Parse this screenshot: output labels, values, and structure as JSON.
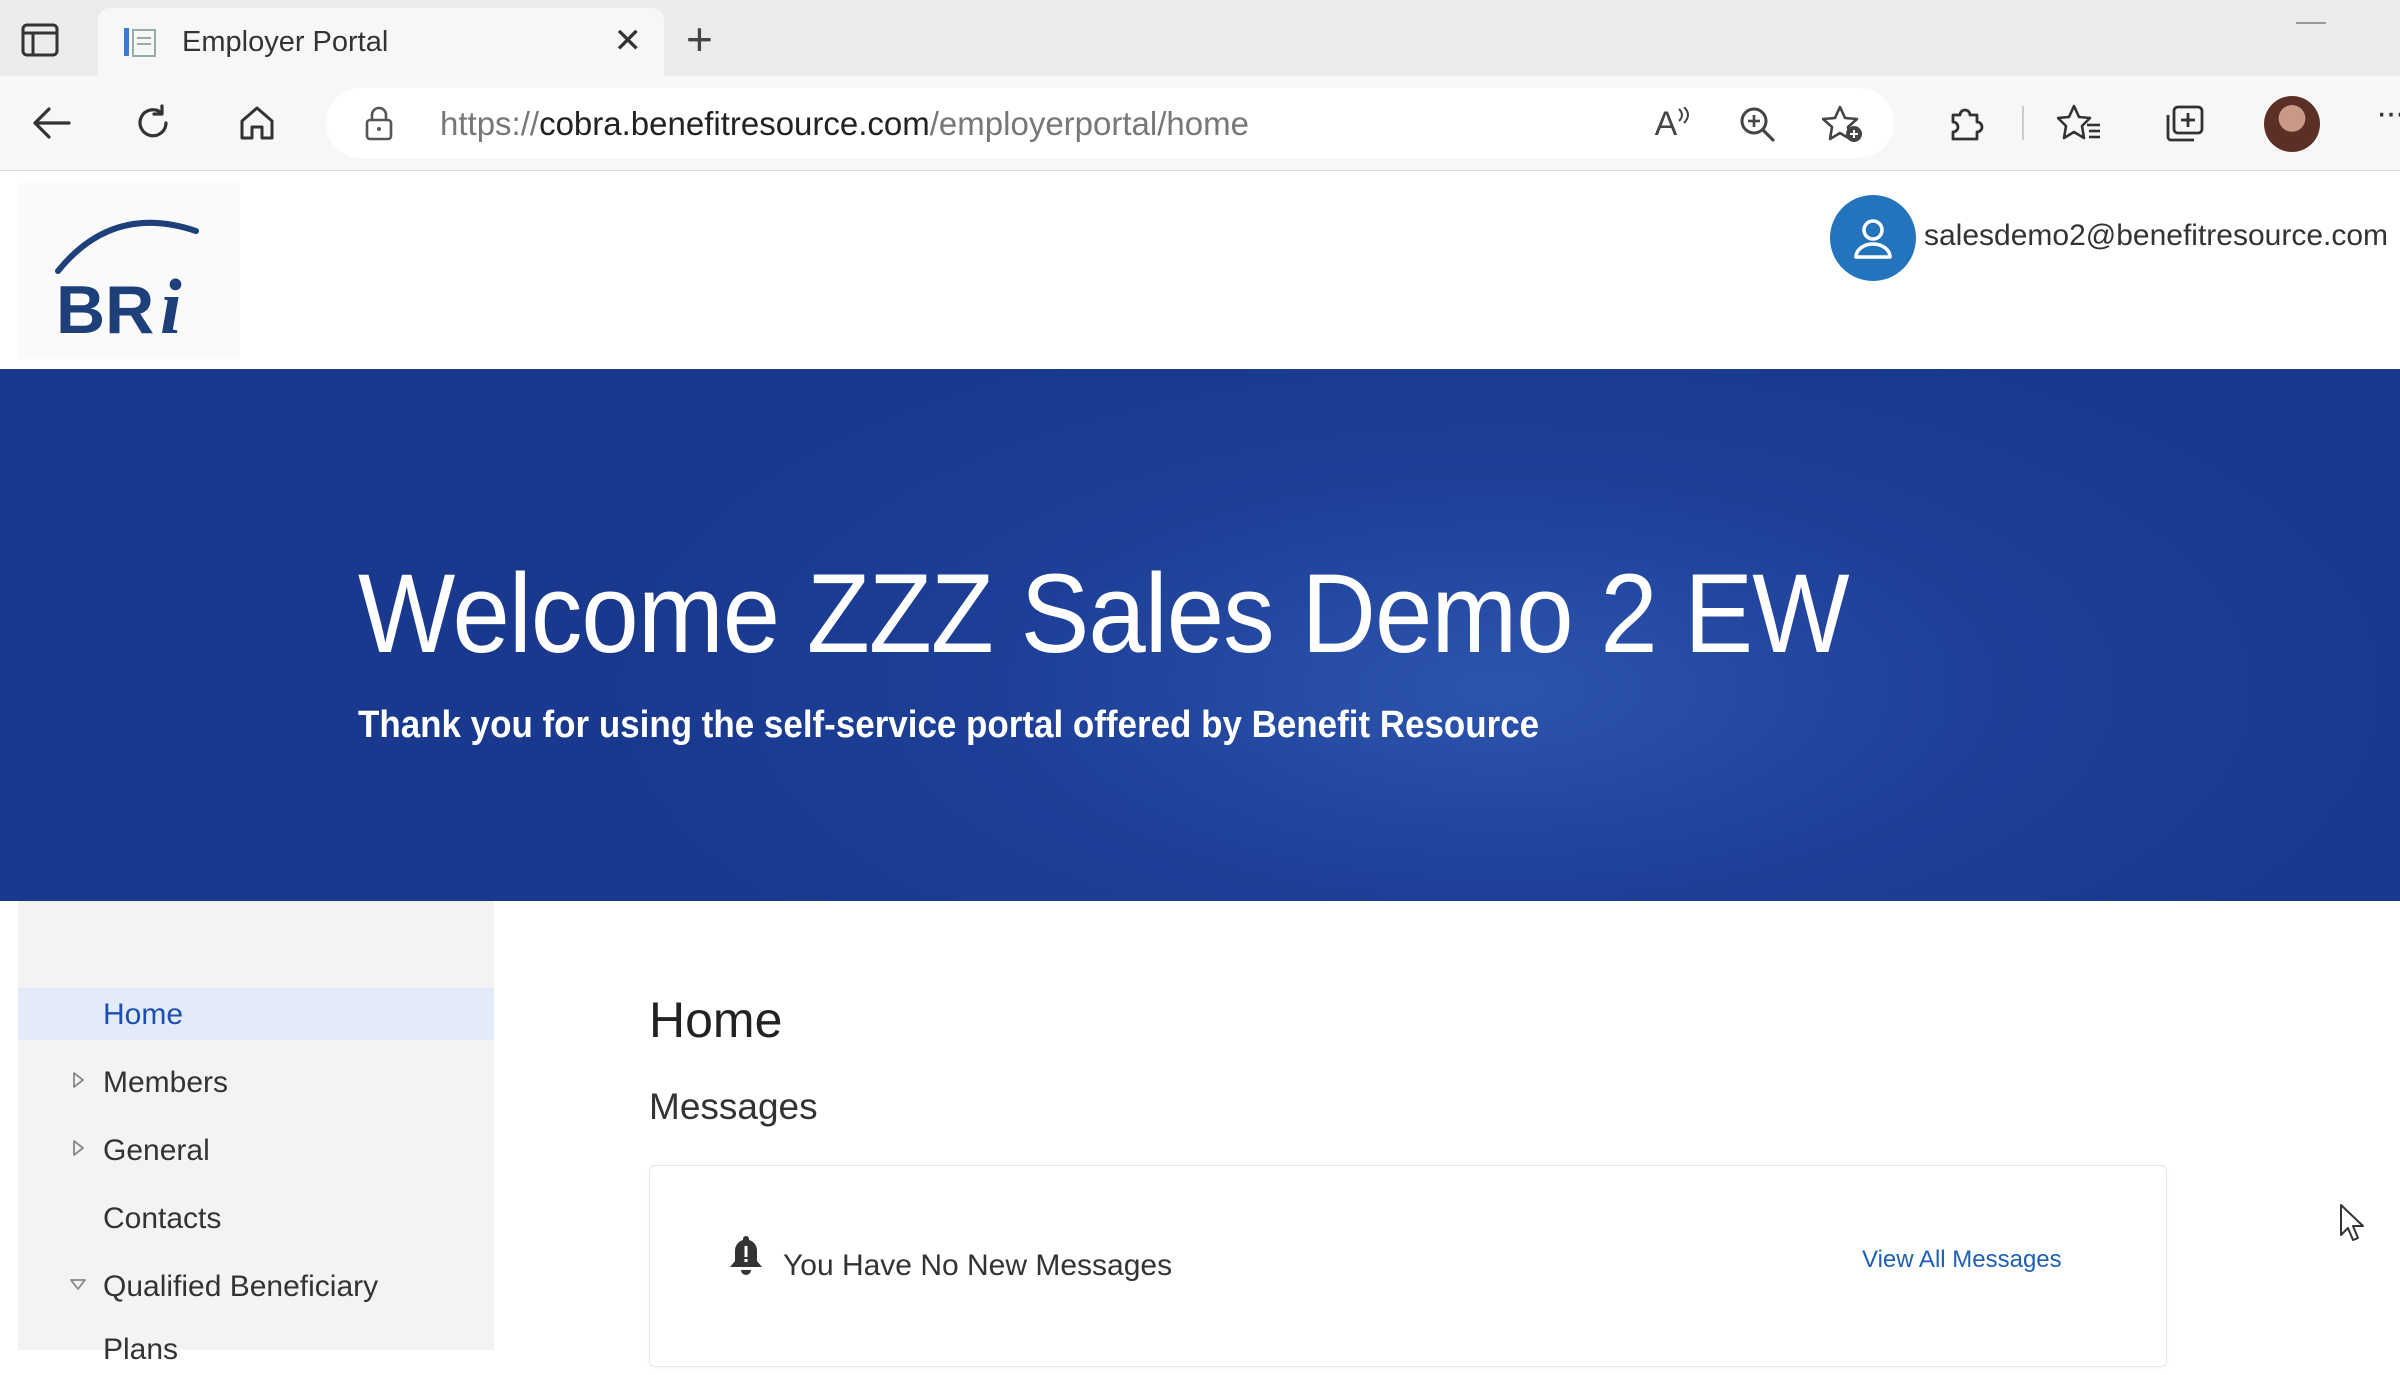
{
  "browser": {
    "tab_title": "Employer Portal",
    "tab_close": "✕",
    "new_tab": "+",
    "url_prefix": "https://",
    "url_host": "cobra.benefitresource.com",
    "url_path": "/employerportal/home",
    "read_aloud_label": "A",
    "more_label": "···"
  },
  "header": {
    "user_email": "salesdemo2@benefitresource.com"
  },
  "hero": {
    "title": "Welcome ZZZ Sales Demo 2 EW",
    "subtitle": "Thank you for using the self-service portal offered by Benefit Resource",
    "colors": {
      "background": "#1d3f97",
      "text": "#ffffff"
    }
  },
  "sidebar": {
    "items": [
      {
        "label": "Home",
        "active": true,
        "caret": "none"
      },
      {
        "label": "Members",
        "active": false,
        "caret": "right"
      },
      {
        "label": "General",
        "active": false,
        "caret": "right"
      },
      {
        "label": "Contacts",
        "active": false,
        "caret": "none"
      },
      {
        "label": "Qualified Beneficiary",
        "active": false,
        "caret": "down"
      },
      {
        "label": "Plans",
        "active": false,
        "caret": "none"
      }
    ]
  },
  "main": {
    "page_title": "Home",
    "section_title": "Messages",
    "messages": {
      "empty_text": "You Have No New Messages",
      "view_all_label": "View All Messages"
    }
  },
  "icons": {
    "tab_actions": "tab-actions-icon",
    "back": "back-arrow-icon",
    "refresh": "refresh-icon",
    "home": "home-icon",
    "lock": "lock-icon",
    "zoom": "zoom-in-icon",
    "favorite_add": "add-favorite-icon",
    "extensions": "puzzle-icon",
    "favorites": "favorites-icon",
    "collections": "collections-icon",
    "user": "user-icon",
    "bell": "bell-icon"
  },
  "colors": {
    "accent": "#1e4fb0",
    "user_icon": "#2474bd",
    "link": "#1e5fb3"
  }
}
